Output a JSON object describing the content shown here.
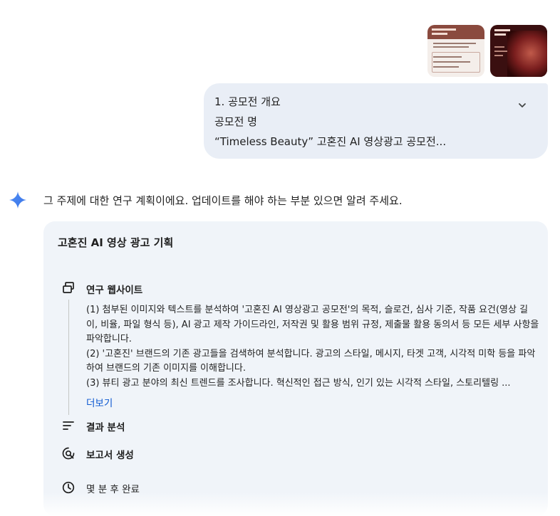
{
  "user_message": {
    "lines": [
      "1. 공모전 개요",
      "공모전 명",
      "“Timeless Beauty” 고혼진 AI 영상광고 공모전..."
    ],
    "attachments": [
      "image-attachment-1",
      "image-attachment-2"
    ]
  },
  "assistant": {
    "reply": "그 주제에 대한 연구 계획이에요. 업데이트를 해야 하는 부분 있으면 알려 주세요.",
    "plan": {
      "title": "고혼진 AI 영상 광고 기획",
      "steps": [
        {
          "label": "연구 웹사이트",
          "icon": "browser-window-icon",
          "description": [
            "(1) 첨부된 이미지와 텍스트를 분석하여 '고혼진 AI 영상광고 공모전'의 목적, 슬로건, 심사 기준, 작품 요건(영상 길이, 비율, 파일 형식 등), AI 광고 제작 가이드라인, 저작권 및 활용 범위 규정, 제출물 활용 동의서 등 모든 세부 사항을 파악합니다.",
            "(2) '고혼진' 브랜드의 기존 광고들을 검색하여 분석합니다. 광고의 스타일, 메시지, 타겟 고객, 시각적 미학 등을 파악하여 브랜드의 기존 이미지를 이해합니다.",
            "(3) 뷰티 광고 분야의 최신 트렌드를 조사합니다. 혁신적인 접근 방식, 인기 있는 시각적 스타일, 스토리텔링 ..."
          ],
          "more_label": "더보기"
        },
        {
          "label": "결과 분석",
          "icon": "sort-lines-icon"
        },
        {
          "label": "보고서 생성",
          "icon": "document-search-icon"
        }
      ],
      "eta": "몇 분 후 완료"
    }
  },
  "colors": {
    "user_bubble": "#e9eef6",
    "plan_card": "#f0f4f9",
    "link": "#0b57d0",
    "gemini_blue": "#4285f4"
  }
}
